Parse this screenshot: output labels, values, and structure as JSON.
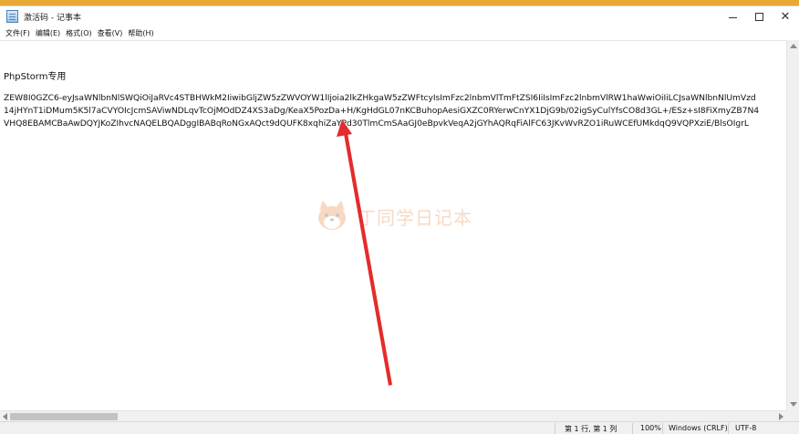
{
  "window": {
    "title": "激活码 - 记事本"
  },
  "menu": [
    {
      "label": "文件(F)"
    },
    {
      "label": "编辑(E)"
    },
    {
      "label": "格式(O)"
    },
    {
      "label": "查看(V)"
    },
    {
      "label": "帮助(H)"
    }
  ],
  "document": {
    "heading": "PhpStorm专用",
    "lines": [
      "ZEW8I0GZC6-eyJsaWNlbnNlSWQiOiJaRVc4STBHWkM2IiwibGljZW5zZWVOYW1lIjoia2lkZHkgaW5zZWFtcyIsImFzc2lnbmVlTmFtZSI6IiIsImFzc2lnbmVlRW1haWwiOiIiLCJsaWNlbnNlUmVzd",
      "14jHYnT1iDMum5K5l7aCVYOIcJcmSAViwNDLqvTcOjMOdDZ4XS3aDg/KeaX5PozDa+H/KgHdGL07nKCBuhopAesiGXZC0RYerwCnYX1DjG9b/02igSyCulYfsCO8d3GL+/ESz+sI8FiXmyZB7N4",
      "VHQ8EBAMCBaAwDQYJKoZIhvcNAQELBQADggIBABqRoNGxAQct9dQUFK8xqhiZaYPd30TlmCmSAaGJ0eBpvkVeqA2jGYhAQRqFiAlFC63JKvWvRZO1iRuWCEfUMkdqQ9VQPXziE/BlsOIgrL"
    ]
  },
  "watermark": {
    "text": "丁同学日记本"
  },
  "status": {
    "position": "第 1 行, 第 1 列",
    "zoom": "100%",
    "line_ending": "Windows (CRLF)",
    "encoding": "UTF-8"
  },
  "colors": {
    "desktop": "#e9a935",
    "annotation_arrow": "#e52b2b",
    "watermark": "#e57a2c"
  },
  "icons": {
    "app": "notepad-icon",
    "minimize": "minimize-icon",
    "maximize": "maximize-icon",
    "close": "close-icon",
    "annotation": "red-arrow-annotation"
  }
}
